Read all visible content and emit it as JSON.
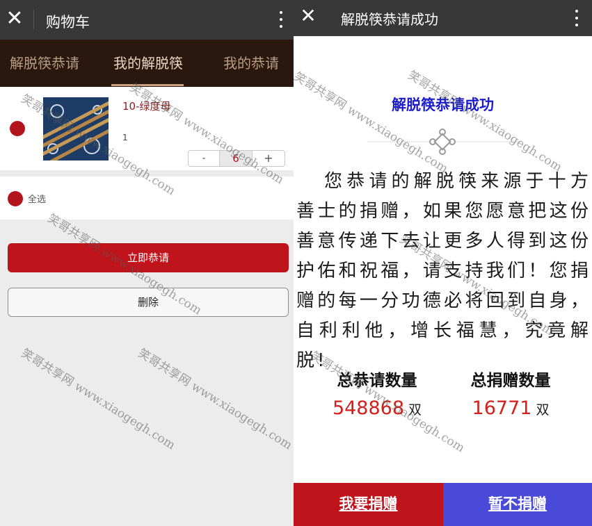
{
  "left": {
    "header": {
      "title": "购物车",
      "close_icon": "close-icon",
      "more_icon": "more-vertical-icon"
    },
    "tabs": [
      {
        "label": "解脱筷恭请",
        "active": false
      },
      {
        "label": "我的解脱筷",
        "active": true
      },
      {
        "label": "我的恭请",
        "active": false
      }
    ],
    "cart_item": {
      "name": "10-绿度母",
      "quantity_text": "1",
      "stepper": {
        "minus": "-",
        "value": "6",
        "plus": "+"
      },
      "selected": true
    },
    "select_all": {
      "label": "全选",
      "selected": true
    },
    "buttons": {
      "request": "立即恭请",
      "delete": "删除"
    }
  },
  "right": {
    "header": {
      "title": "解脱筷恭请成功",
      "close_icon": "close-icon",
      "more_icon": "more-vertical-icon"
    },
    "dialog_title": "解脱筷恭请成功",
    "ornament_icon": "endless-knot-icon",
    "body": "您恭请的解脱筷来源于十方善士的捐赠，如果您愿意把这份善意传递下去让更多人得到这份护佑和祝福，请支持我们！您捐赠的每一分功德必将回到自身，自利利他，增长福慧，究竟解脱!",
    "stats": [
      {
        "label": "总恭请数量",
        "value": "548868",
        "unit": "双"
      },
      {
        "label": "总捐赠数量",
        "value": "16771",
        "unit": "双"
      }
    ],
    "buttons": {
      "donate": "我要捐赠",
      "skip": "暂不捐赠"
    }
  },
  "watermark": {
    "text": "笑哥共享网 www.xiaogegh.com"
  },
  "colors": {
    "brand_red": "#c0141c",
    "tab_bar": "#2a170d",
    "title_blue": "#1c1ccc",
    "skip_blue": "#4a4ad8",
    "number_red": "#d2201c"
  }
}
